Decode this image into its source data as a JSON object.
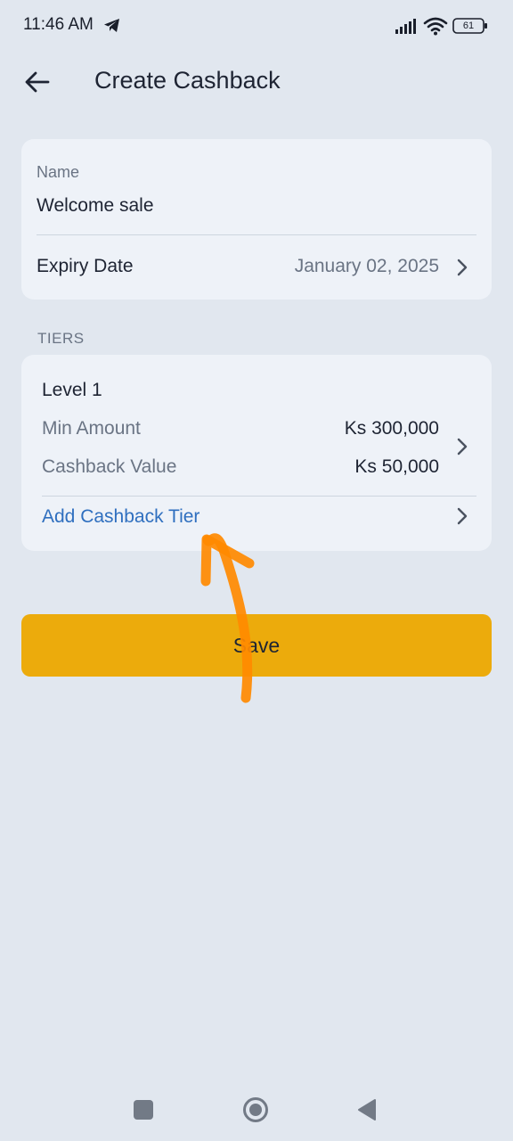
{
  "status_bar": {
    "time": "11:46 AM",
    "battery": "61"
  },
  "header": {
    "title": "Create Cashback"
  },
  "details": {
    "name_label": "Name",
    "name_value": "Welcome sale",
    "expiry_label": "Expiry Date",
    "expiry_value": "January 02, 2025"
  },
  "tiers": {
    "section_label": "TIERS",
    "items": [
      {
        "level": "Level 1",
        "min_amount_label": "Min Amount",
        "min_amount_value": "Ks 300,000",
        "cashback_value_label": "Cashback Value",
        "cashback_value": "Ks 50,000"
      }
    ],
    "add_label": "Add Cashback Tier"
  },
  "actions": {
    "save_label": "Save"
  },
  "colors": {
    "background": "#e1e7ef",
    "card": "#eef2f8",
    "accent": "#ecab0c",
    "link": "#2f6fbf",
    "annotation": "#ff8a00"
  },
  "icons": [
    "telegram-icon",
    "signal-icon",
    "wifi-icon",
    "battery-icon",
    "back-arrow-icon",
    "chevron-right-icon",
    "nav-recents-icon",
    "nav-home-icon",
    "nav-back-icon"
  ]
}
